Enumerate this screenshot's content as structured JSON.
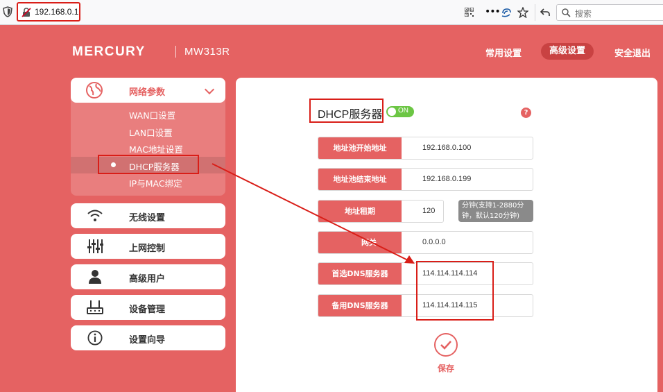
{
  "browser": {
    "url": "192.168.0.1",
    "search_placeholder": "搜索",
    "more_label": "•••"
  },
  "header": {
    "brand": "MERCURY",
    "model": "MW313R",
    "nav": [
      "常用设置",
      "高级设置",
      "安全退出"
    ],
    "active_nav": "高级设置"
  },
  "sidebar": {
    "network": {
      "label": "网络参数",
      "sub_items": [
        "WAN口设置",
        "LAN口设置",
        "MAC地址设置",
        "DHCP服务器",
        "IP与MAC绑定"
      ],
      "selected": "DHCP服务器"
    },
    "items": [
      {
        "label": "无线设置",
        "icon": "wifi-icon"
      },
      {
        "label": "上网控制",
        "icon": "sliders-icon"
      },
      {
        "label": "高级用户",
        "icon": "user-icon"
      },
      {
        "label": "设备管理",
        "icon": "router-icon"
      },
      {
        "label": "设置向导",
        "icon": "info-icon"
      }
    ]
  },
  "main": {
    "title": "DHCP服务器",
    "toggle": "ON",
    "help": "?",
    "fields": [
      {
        "label": "地址池开始地址",
        "value": "192.168.0.100"
      },
      {
        "label": "地址池结束地址",
        "value": "192.168.0.199"
      },
      {
        "label": "地址租期",
        "value": "120",
        "hint_line1": "分钟(支持1-2880分",
        "hint_line2": "钟，默认120分钟)"
      },
      {
        "label": "网关",
        "value": "0.0.0.0"
      },
      {
        "label": "首选DNS服务器",
        "value": "114.114.114.114"
      },
      {
        "label": "备用DNS服务器",
        "value": "114.114.114.115"
      }
    ],
    "save_label": "保存"
  },
  "colors": {
    "brand_red": "#e56262",
    "annotation_red": "#d91e18",
    "toggle_green": "#6cc644"
  }
}
